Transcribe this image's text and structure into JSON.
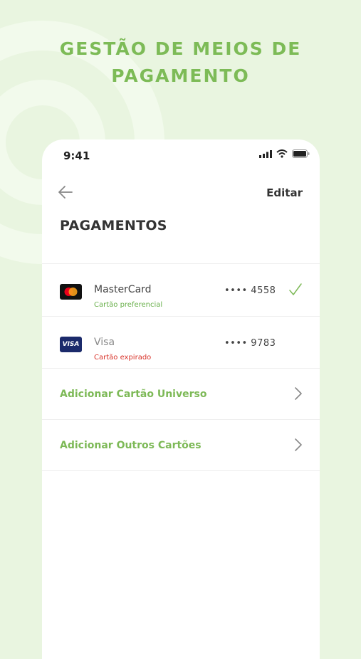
{
  "headline": {
    "line1": "GESTÃO DE MEIOS DE",
    "line2": "PAGAMENTO"
  },
  "status_bar": {
    "time": "9:41"
  },
  "nav": {
    "edit_label": "Editar"
  },
  "page": {
    "title": "PAGAMENTOS"
  },
  "cards": [
    {
      "brand": "MasterCard",
      "status": "Cartão preferencial",
      "status_color": "#6ab04c",
      "number": "•••• 4558",
      "selected": true
    },
    {
      "brand": "Visa",
      "logo_text": "VISA",
      "status": "Cartão expirado",
      "status_color": "#d9342b",
      "number": "•••• 9783",
      "selected": false
    }
  ],
  "actions": [
    {
      "label": "Adicionar Cartão Universo"
    },
    {
      "label": "Adicionar Outros Cartões"
    }
  ],
  "colors": {
    "accent": "#7db957",
    "background": "#e9f5e0",
    "error": "#d9342b"
  }
}
